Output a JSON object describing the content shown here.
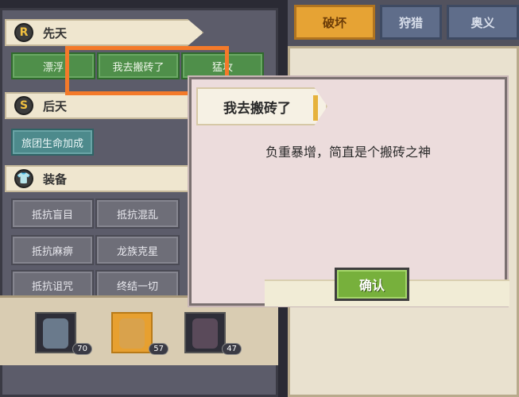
{
  "left": {
    "section1": {
      "icon": "R",
      "title": "先天"
    },
    "section1_buttons": [
      "漂浮",
      "我去搬砖了",
      "猛攻"
    ],
    "section2": {
      "icon": "S",
      "title": "后天"
    },
    "section2_buttons": [
      "旅团生命加成"
    ],
    "section3": {
      "icon": "👕",
      "title": "装备"
    },
    "equip_buttons": [
      "抵抗盲目",
      "抵抗混乱",
      "抵抗麻痹",
      "龙族克星",
      "抵抗诅咒",
      "终结一切"
    ],
    "characters": [
      {
        "level": "70",
        "color": "#6a7a8c"
      },
      {
        "level": "57",
        "color": "#d9a24c"
      },
      {
        "level": "47",
        "color": "#5a4a5a"
      }
    ]
  },
  "right": {
    "tabs": [
      "破坏",
      "狩猎",
      "奥义"
    ]
  },
  "dialog": {
    "title": "我去搬砖了",
    "message": "负重暴增，简直是个搬砖之神",
    "confirm_label": "确认"
  },
  "colors": {
    "highlight": "#f47a2a",
    "confirm_green": "#77b03c",
    "active_tab": "#e6a334"
  }
}
